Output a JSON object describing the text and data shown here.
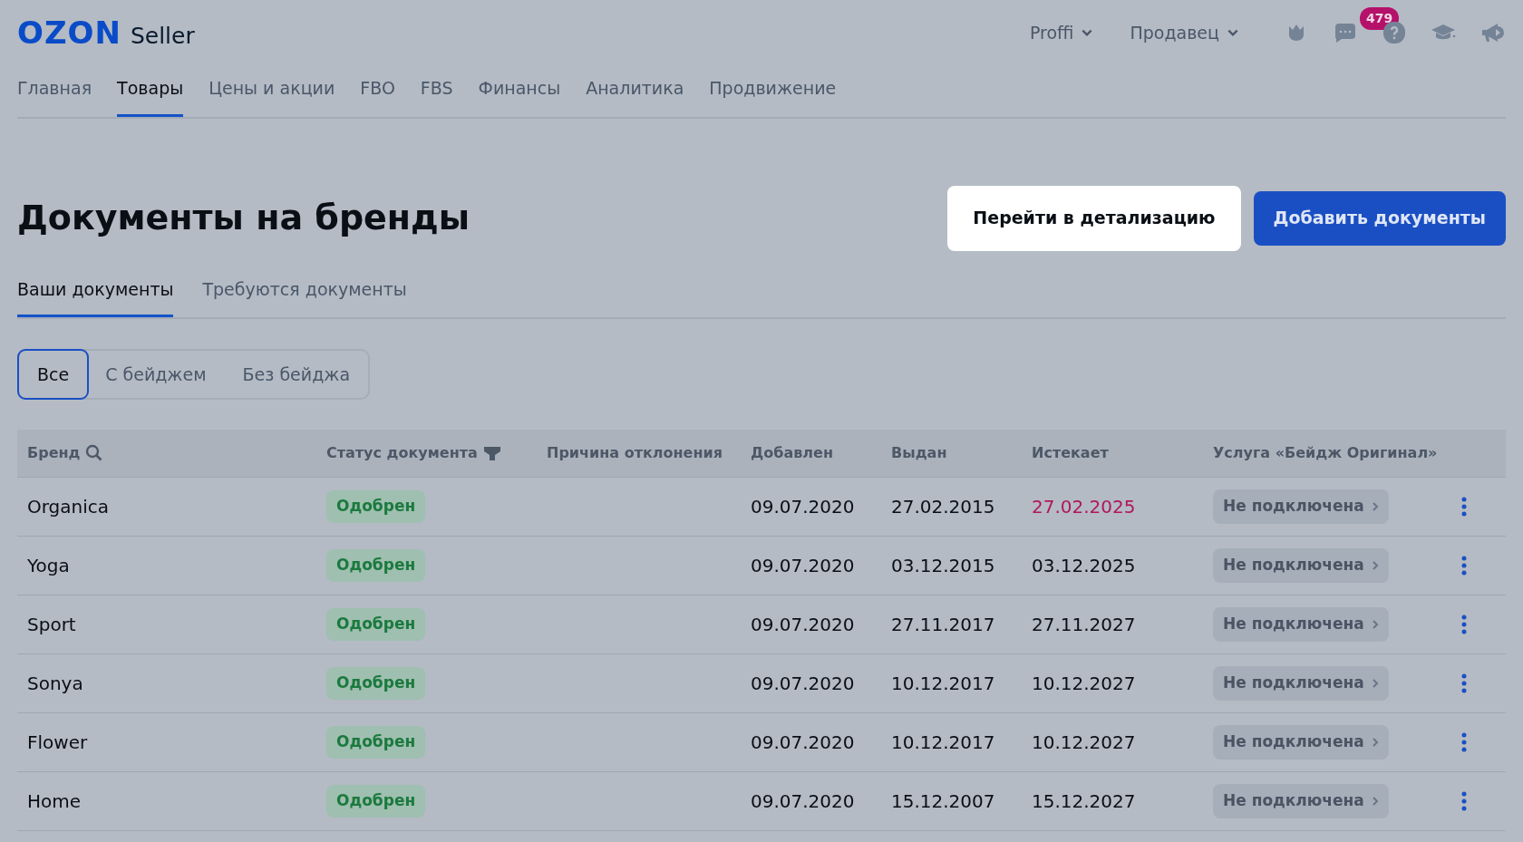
{
  "header": {
    "logo": "OZON",
    "logo_suffix": "Seller",
    "menus": [
      {
        "label": "Proffi"
      },
      {
        "label": "Продавец"
      }
    ],
    "chat_badge": "479"
  },
  "nav": [
    {
      "label": "Главная",
      "selected": false
    },
    {
      "label": "Товары",
      "selected": true
    },
    {
      "label": "Цены и акции",
      "selected": false
    },
    {
      "label": "FBO",
      "selected": false
    },
    {
      "label": "FBS",
      "selected": false
    },
    {
      "label": "Финансы",
      "selected": false
    },
    {
      "label": "Аналитика",
      "selected": false
    },
    {
      "label": "Продвижение",
      "selected": false
    }
  ],
  "page": {
    "title": "Документы на бренды",
    "buttons": [
      {
        "label": "Перейти в детализацию",
        "kind": "highlighted"
      },
      {
        "label": "Добавить документы",
        "kind": "primary"
      }
    ]
  },
  "tabs": [
    {
      "label": "Ваши документы",
      "selected": true
    },
    {
      "label": "Требуются документы",
      "selected": false
    }
  ],
  "filters": [
    {
      "label": "Все",
      "selected": true
    },
    {
      "label": "С бейджем",
      "selected": false
    },
    {
      "label": "Без бейджа",
      "selected": false
    }
  ],
  "table": {
    "columns": [
      "Бренд",
      "Статус документа",
      "Причина отклонения",
      "Добавлен",
      "Выдан",
      "Истекает",
      "Услуга «Бейдж Оригинал»"
    ],
    "rows": [
      {
        "brand": "Organica",
        "status": "Одобрен",
        "reason": "",
        "added": "09.07.2020",
        "issued": "27.02.2015",
        "expires": "27.02.2025",
        "expiring": true,
        "service": "Не подключена"
      },
      {
        "brand": "Yoga",
        "status": "Одобрен",
        "added": "09.07.2020",
        "issued": "03.12.2015",
        "expires": "03.12.2025",
        "expiring": false,
        "service": "Не подключена"
      },
      {
        "brand": "Sport",
        "status": "Одобрен",
        "added": "09.07.2020",
        "issued": "27.11.2017",
        "expires": "27.11.2027",
        "expiring": false,
        "service": "Не подключена"
      },
      {
        "brand": "Sonya",
        "status": "Одобрен",
        "added": "09.07.2020",
        "issued": "10.12.2017",
        "expires": "10.12.2027",
        "expiring": false,
        "service": "Не подключена"
      },
      {
        "brand": "Flower",
        "status": "Одобрен",
        "added": "09.07.2020",
        "issued": "10.12.2017",
        "expires": "10.12.2027",
        "expiring": false,
        "service": "Не подключена"
      },
      {
        "brand": "Home",
        "status": "Одобрен",
        "added": "09.07.2020",
        "issued": "15.12.2007",
        "expires": "15.12.2027",
        "expiring": false,
        "service": "Не подключена"
      }
    ]
  }
}
